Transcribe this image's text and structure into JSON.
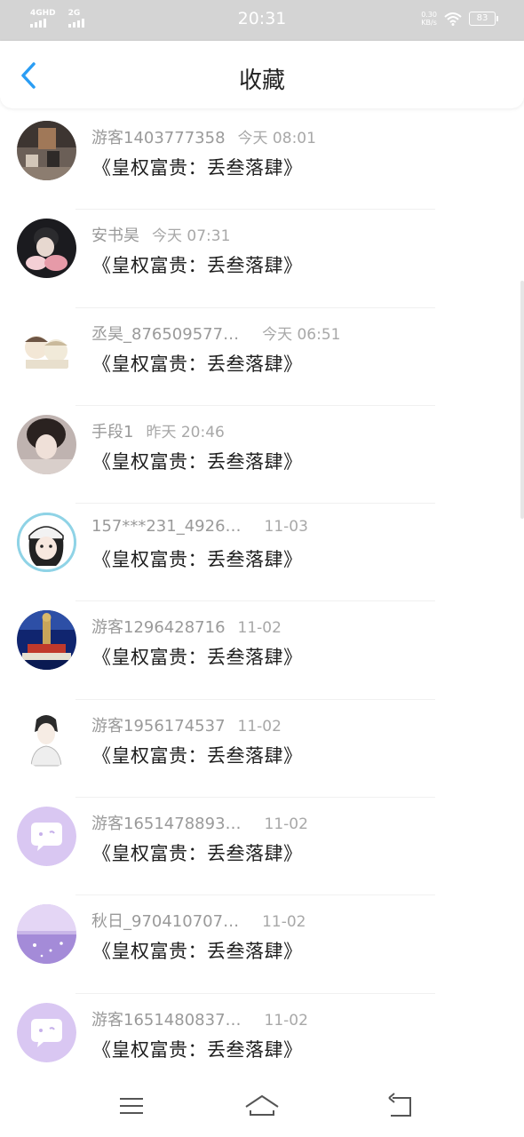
{
  "status_bar": {
    "signal1": "4GHD",
    "signal2": "2G",
    "time": "20:31",
    "net_speed_value": "0.30",
    "net_speed_unit": "KB/s",
    "battery": "83"
  },
  "header": {
    "title": "收藏",
    "back_icon": "chevron-left-icon",
    "accent": "#2a9df4"
  },
  "items": [
    {
      "user": "游客1403777358",
      "time": "今天 08:01",
      "content": "《皇权富贵：丢叁落肆》"
    },
    {
      "user": "安书昊",
      "time": "今天 07:31",
      "content": "《皇权富贵：丢叁落肆》"
    },
    {
      "user": "丞昊_876509577…",
      "time": "今天 06:51",
      "content": "《皇权富贵：丢叁落肆》"
    },
    {
      "user": "手段1",
      "time": "昨天 20:46",
      "content": "《皇权富贵：丢叁落肆》"
    },
    {
      "user": "157***231_4926…",
      "time": "11-03",
      "content": "《皇权富贵：丢叁落肆》"
    },
    {
      "user": "游客1296428716",
      "time": "11-02",
      "content": "《皇权富贵：丢叁落肆》"
    },
    {
      "user": "游客1956174537",
      "time": "11-02",
      "content": "《皇权富贵：丢叁落肆》"
    },
    {
      "user": "游客1651478893…",
      "time": "11-02",
      "content": "《皇权富贵：丢叁落肆》"
    },
    {
      "user": "秋日_970410707…",
      "time": "11-02",
      "content": "《皇权富贵：丢叁落肆》"
    },
    {
      "user": "游客1651480837…",
      "time": "11-02",
      "content": "《皇权富贵：丢叁落肆》"
    }
  ],
  "nav": {
    "menu_icon": "menu-icon",
    "home_icon": "home-icon",
    "back_icon": "back-arrow-icon"
  }
}
